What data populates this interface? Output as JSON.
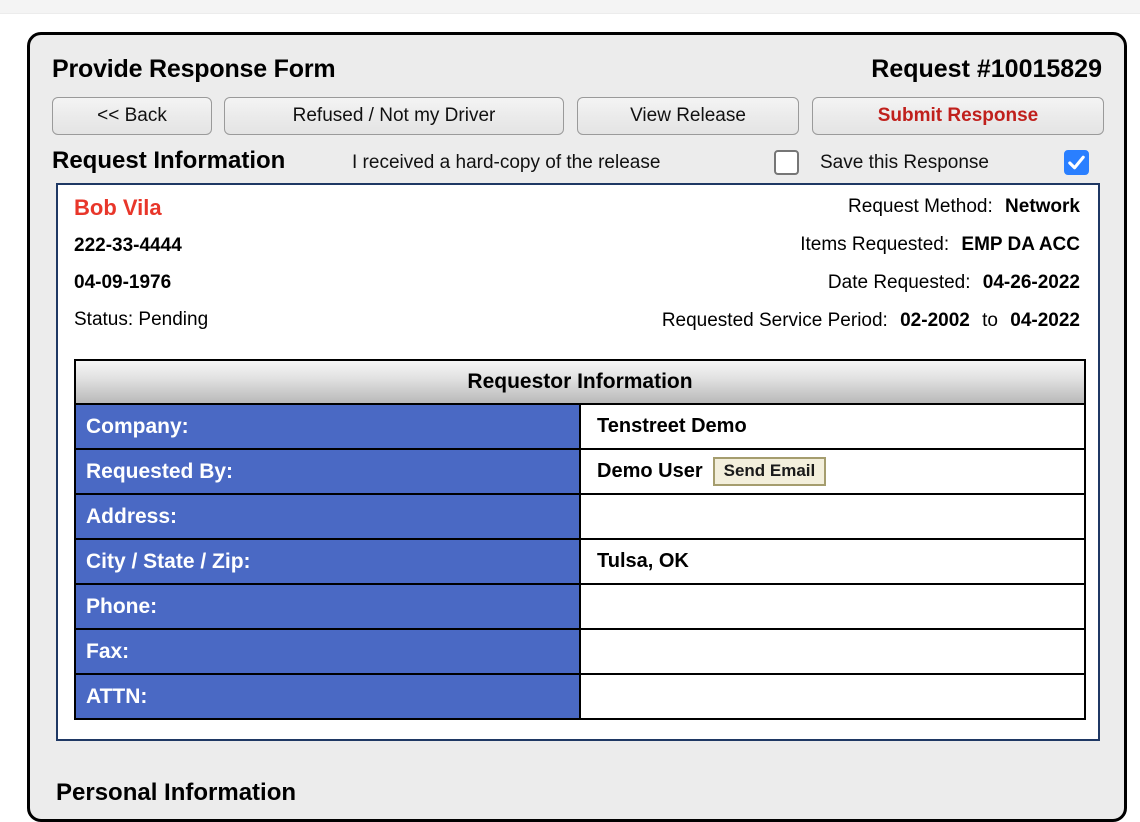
{
  "header": {
    "page_title": "Provide Response Form",
    "request_number": "Request #10015829"
  },
  "toolbar": {
    "back_label": "<< Back",
    "refused_label": "Refused / Not my Driver",
    "view_release_label": "View Release",
    "submit_label": "Submit Response"
  },
  "section": {
    "title": "Request Information",
    "hardcopy_label": "I received a hard-copy of the release",
    "hardcopy_checked": false,
    "save_label": "Save this Response",
    "save_checked": true
  },
  "driver": {
    "name": "Bob Vila",
    "ssn": "222-33-4444",
    "dob": "04-09-1976",
    "status": "Status: Pending"
  },
  "meta": {
    "request_method_label": "Request Method:",
    "request_method_value": "Network",
    "items_requested_label": "Items Requested:",
    "items_requested_value": "EMP DA ACC",
    "date_requested_label": "Date Requested:",
    "date_requested_value": "04-26-2022",
    "service_period_label": "Requested Service Period:",
    "service_period_from": "02-2002",
    "service_period_joiner": "to",
    "service_period_to": "04-2022"
  },
  "requestor_table": {
    "header": "Requestor Information",
    "rows": [
      {
        "key": "Company:",
        "value": "Tenstreet Demo"
      },
      {
        "key": "Requested By:",
        "value": "Demo User",
        "button": "Send Email"
      },
      {
        "key": "Address:",
        "value": ""
      },
      {
        "key": "City / State / Zip:",
        "value": "Tulsa, OK"
      },
      {
        "key": "Phone:",
        "value": ""
      },
      {
        "key": "Fax:",
        "value": ""
      },
      {
        "key": "ATTN:",
        "value": ""
      }
    ]
  },
  "personal_section": {
    "title": "Personal Information"
  },
  "colors": {
    "accent_red": "#e8362a",
    "submit_red": "#c0201c",
    "label_blue": "#4a69c4",
    "panel_border": "#1f3864",
    "checkbox_blue": "#2a7fff",
    "send_email_bg": "#f3efdc",
    "send_email_border": "#a59d6e"
  }
}
